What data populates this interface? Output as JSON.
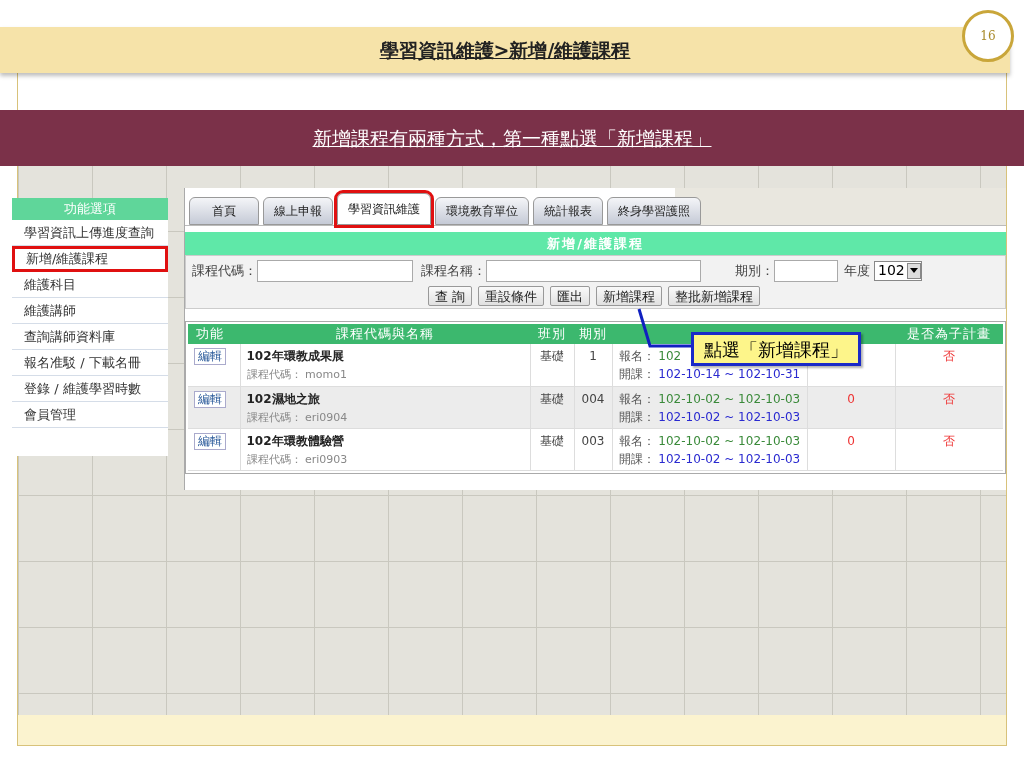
{
  "slide": {
    "title": "學習資訊維護>新增/維護課程",
    "page_number": "16",
    "banner": "新增課程有兩種方式，第一種點選「新增課程」"
  },
  "sidebar": {
    "title": "功能選項",
    "items": [
      {
        "label": "學習資訊上傳進度查詢",
        "highlighted": false
      },
      {
        "label": "新增/維護課程",
        "highlighted": true
      },
      {
        "label": "維護科目",
        "highlighted": false
      },
      {
        "label": "維護講師",
        "highlighted": false
      },
      {
        "label": "查詢講師資料庫",
        "highlighted": false
      },
      {
        "label": "報名准駁 / 下載名冊",
        "highlighted": false
      },
      {
        "label": "登錄 / 維護學習時數",
        "highlighted": false
      },
      {
        "label": "會員管理",
        "highlighted": false
      }
    ]
  },
  "tabs": [
    {
      "label": "首頁",
      "selected": false
    },
    {
      "label": "線上申報",
      "selected": false
    },
    {
      "label": "學習資訊維護",
      "selected": true
    },
    {
      "label": "環境教育單位",
      "selected": false
    },
    {
      "label": "統計報表",
      "selected": false
    },
    {
      "label": "終身學習護照",
      "selected": false
    }
  ],
  "form": {
    "title": "新增/維護課程",
    "fields": [
      {
        "label": "課程代碼：",
        "kind": "text"
      },
      {
        "label": "課程名稱：",
        "kind": "text"
      },
      {
        "label": "期別：",
        "kind": "text"
      },
      {
        "label": "年度",
        "kind": "select",
        "value": "102"
      }
    ],
    "buttons": [
      "查 詢",
      "重設條件",
      "匯出",
      "新增課程",
      "整批新增課程"
    ]
  },
  "table": {
    "columns": [
      "功能",
      "課程代碼與名稱",
      "班別",
      "期別",
      "",
      "",
      "是否為子計畫"
    ],
    "rows": [
      {
        "action": "編輯",
        "name": "102年環教成果展",
        "code_label": "課程代碼：",
        "code": "momo1",
        "class": "基礎",
        "period": "1",
        "reg_label": "報名：",
        "reg": "102",
        "open_label": "開課：",
        "open": "102-10-14 ~ 102-10-31",
        "count": "",
        "sub": "否"
      },
      {
        "action": "編輯",
        "name": "102濕地之旅",
        "code_label": "課程代碼：",
        "code": "eri0904",
        "class": "基礎",
        "period": "004",
        "reg_label": "報名：",
        "reg": "102-10-02 ~ 102-10-03",
        "open_label": "開課：",
        "open": "102-10-02 ~ 102-10-03",
        "count": "0",
        "sub": "否"
      },
      {
        "action": "編輯",
        "name": "102年環教體驗營",
        "code_label": "課程代碼：",
        "code": "eri0903",
        "class": "基礎",
        "period": "003",
        "reg_label": "報名：",
        "reg": "102-10-02 ~ 102-10-03",
        "open_label": "開課：",
        "open": "102-10-02 ~ 102-10-03",
        "count": "0",
        "sub": "否"
      }
    ]
  },
  "callout": "點選「新增課程」"
}
